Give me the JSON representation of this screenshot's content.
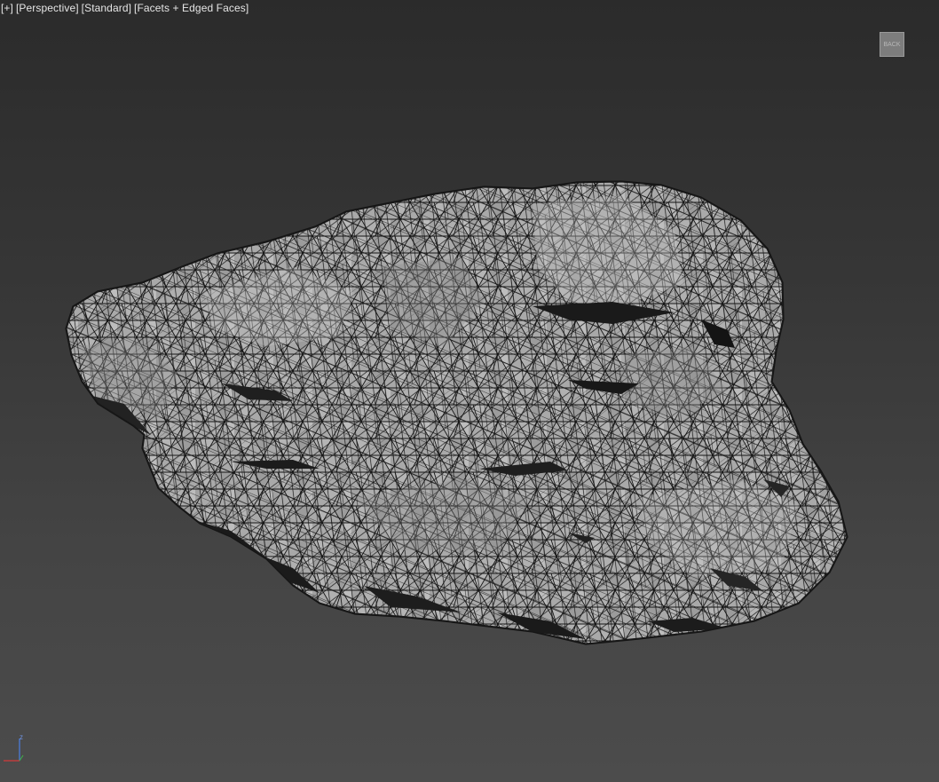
{
  "viewport": {
    "labels": {
      "menu": "[+]",
      "view": "[Perspective]",
      "shading_style": "[Standard]",
      "display_mode": "[Facets + Edged Faces]"
    },
    "viewcube_label": "BACK",
    "axis": {
      "z_label": "z"
    },
    "colors": {
      "background_top": "#2b2b2b",
      "background_bottom": "#4c4c4c",
      "mesh_face": "#a8a8a8",
      "mesh_edge": "#151515",
      "axis_z": "#4b7bd9",
      "axis_x": "#d23a3a"
    },
    "object": "rock-mesh"
  }
}
